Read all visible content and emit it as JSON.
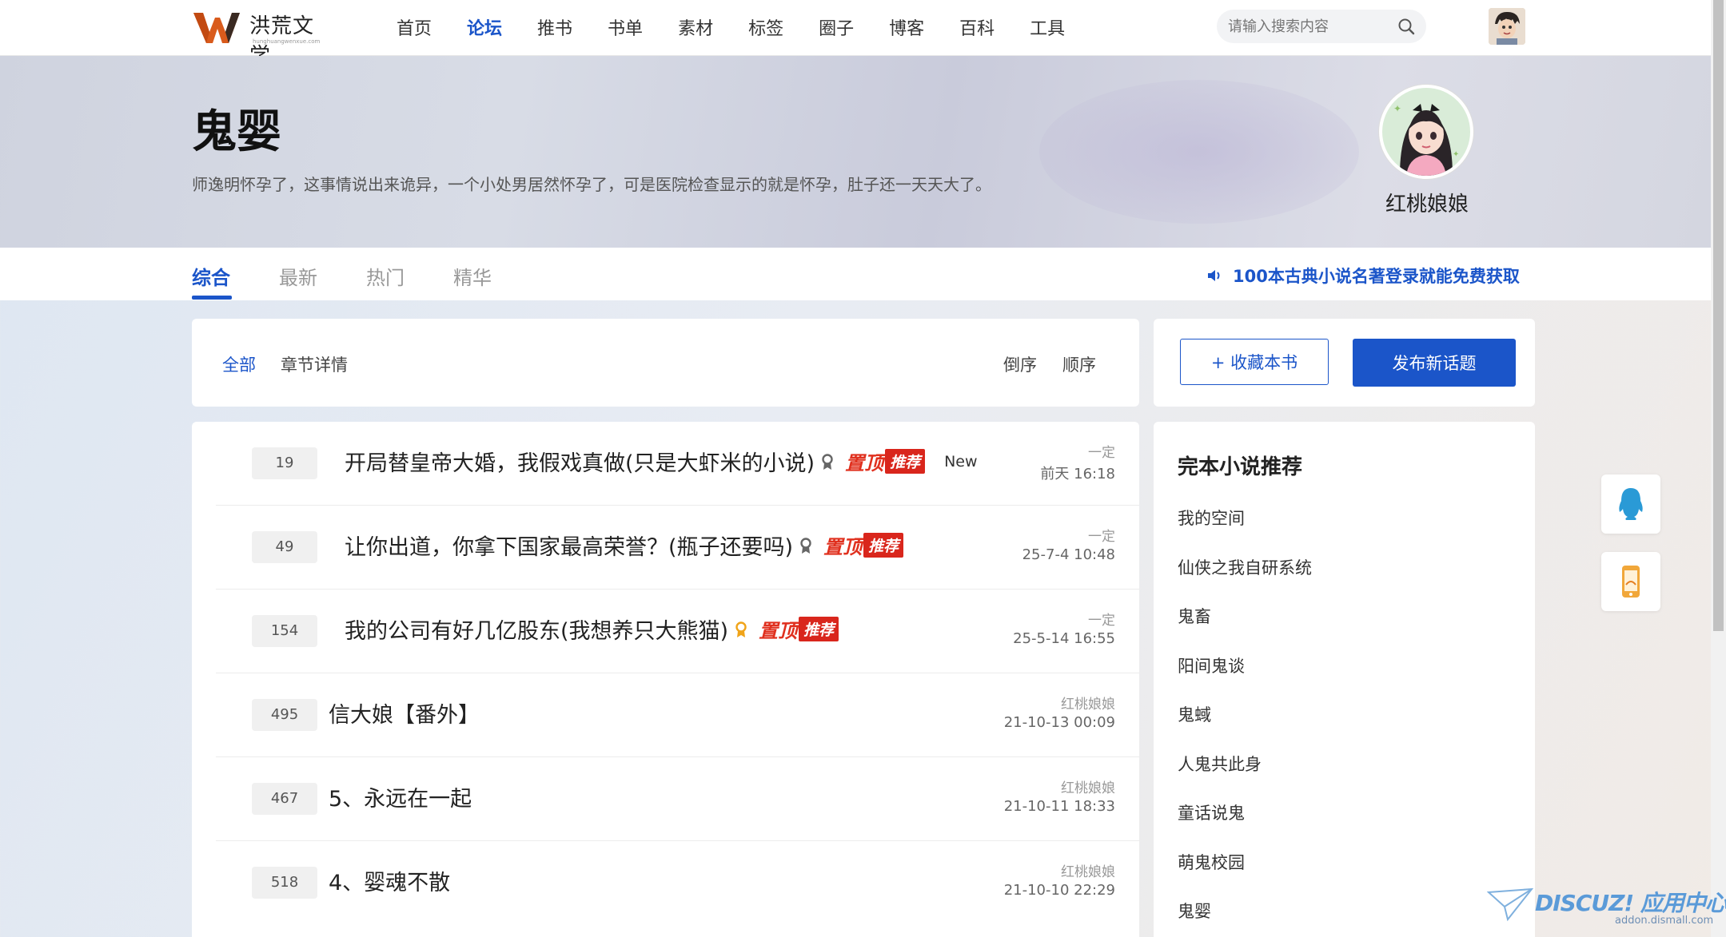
{
  "brand": {
    "name": "洪荒文学",
    "sub": "hunghuangwenxue.com",
    "colors": {
      "primary": "#1b55c9",
      "accent_red": "#d9261c"
    }
  },
  "nav": {
    "items": [
      {
        "label": "首页",
        "active": false
      },
      {
        "label": "论坛",
        "active": true
      },
      {
        "label": "推书",
        "active": false
      },
      {
        "label": "书单",
        "active": false
      },
      {
        "label": "素材",
        "active": false
      },
      {
        "label": "标签",
        "active": false
      },
      {
        "label": "圈子",
        "active": false
      },
      {
        "label": "博客",
        "active": false
      },
      {
        "label": "百科",
        "active": false
      },
      {
        "label": "工具",
        "active": false
      }
    ],
    "search_placeholder": "请输入搜索内容"
  },
  "banner": {
    "title": "鬼婴",
    "description": "师逸明怀孕了，这事情说出来诡异，一个小处男居然怀孕了，可是医院检查显示的就是怀孕，肚子还一天天大了。",
    "author": "红桃娘娘"
  },
  "tabs": [
    "综合",
    "最新",
    "热门",
    "精华"
  ],
  "promo": "100本古典小说名著登录就能免费获取",
  "filter": {
    "all": "全部",
    "chapter": "章节详情",
    "sort_desc": "倒序",
    "sort_asc": "顺序"
  },
  "actions": {
    "favorite": "+ 收藏本书",
    "post": "发布新话题"
  },
  "threads": [
    {
      "replies": "19",
      "title": "开局替皇帝大婚，我假戏真做(只是大虾米的小说)",
      "pinned": true,
      "tag_top": "置顶",
      "tag_rec": "推荐",
      "new_label": "New",
      "medal": "medal-gray",
      "author": "一定",
      "time": "前天 16:18"
    },
    {
      "replies": "49",
      "title": "让你出道，你拿下国家最高荣誉？(瓶子还要吗)",
      "pinned": true,
      "tag_top": "置顶",
      "tag_rec": "推荐",
      "medal": "medal-gray",
      "author": "一定",
      "time": "25-7-4 10:48"
    },
    {
      "replies": "154",
      "title": "我的公司有好几亿股东(我想养只大熊猫)",
      "pinned": true,
      "tag_top": "置顶",
      "tag_rec": "推荐",
      "medal": "medal-gold",
      "author": "一定",
      "time": "25-5-14 16:55"
    },
    {
      "replies": "495",
      "title": "信大娘【番外】",
      "pinned": false,
      "author": "红桃娘娘",
      "time": "21-10-13 00:09"
    },
    {
      "replies": "467",
      "title": "5、永远在一起",
      "pinned": false,
      "author": "红桃娘娘",
      "time": "21-10-11 18:33"
    },
    {
      "replies": "518",
      "title": "4、婴魂不散",
      "pinned": false,
      "author": "红桃娘娘",
      "time": "21-10-10 22:29"
    }
  ],
  "recommend": {
    "title": "完本小说推荐",
    "items": [
      "我的空间",
      "仙侠之我自研系统",
      "鬼畜",
      "阳间鬼谈",
      "鬼蜮",
      "人鬼共此身",
      "童话说鬼",
      "萌鬼校园",
      "鬼婴"
    ]
  },
  "watermark": {
    "main": "DISCUZ! 应用中心",
    "sub": "addon.dismall.com"
  }
}
